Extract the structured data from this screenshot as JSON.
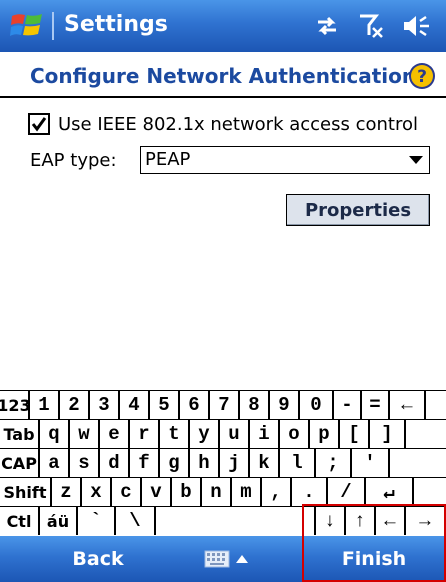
{
  "titlebar": {
    "title": "Settings",
    "start_icon": "windows-flag-icon",
    "status_icons": [
      "connectivity-icon",
      "signal-off-icon",
      "speaker-icon"
    ]
  },
  "header": {
    "title": "Configure Network Authentication",
    "help_icon": "help-icon"
  },
  "content": {
    "checkbox_label": "Use IEEE 802.1x network access control",
    "checkbox_checked": true,
    "eap_label": "EAP type:",
    "eap_value": "PEAP",
    "properties_button": "Properties"
  },
  "keyboard": {
    "rows": [
      [
        "123",
        "1",
        "2",
        "3",
        "4",
        "5",
        "6",
        "7",
        "8",
        "9",
        "0",
        "-",
        "=",
        "←"
      ],
      [
        "Tab",
        "q",
        "w",
        "e",
        "r",
        "t",
        "y",
        "u",
        "i",
        "o",
        "p",
        "[",
        "]"
      ],
      [
        "CAP",
        "a",
        "s",
        "d",
        "f",
        "g",
        "h",
        "j",
        "k",
        "l",
        ";",
        "'"
      ],
      [
        "Shift",
        "z",
        "x",
        "c",
        "v",
        "b",
        "n",
        "m",
        ",",
        ".",
        "/",
        "↵"
      ],
      [
        "Ctl",
        "áü",
        "`",
        "\\",
        "",
        "↓",
        "↑",
        "←",
        "→"
      ]
    ]
  },
  "softkeys": {
    "left": "Back",
    "right": "Finish",
    "input_icon": "keyboard-icon"
  },
  "colors": {
    "bar": "#2f72d0",
    "header_text": "#1c4aa0",
    "highlight": "#d40000"
  }
}
